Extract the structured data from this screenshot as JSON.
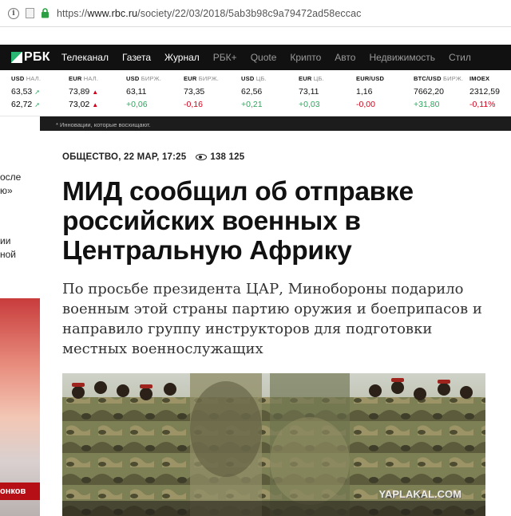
{
  "browser": {
    "url_scheme": "https://",
    "url_host": "www.rbc.ru",
    "url_path": "/society/22/03/2018/5ab3b98c9a79472ad58eccac"
  },
  "nav": {
    "logo": "РБК",
    "items": [
      {
        "label": "Телеканал",
        "dim": false
      },
      {
        "label": "Газета",
        "dim": false
      },
      {
        "label": "Журнал",
        "dim": false
      },
      {
        "label": "РБК+",
        "dim": true
      },
      {
        "label": "Quote",
        "dim": true
      },
      {
        "label": "Крипто",
        "dim": true
      },
      {
        "label": "Авто",
        "dim": true
      },
      {
        "label": "Недвижимость",
        "dim": true
      },
      {
        "label": "Стил",
        "dim": true
      }
    ]
  },
  "tickers": [
    {
      "label": "USD",
      "sub": "НАЛ.",
      "v1": "63,53",
      "d1": "up",
      "v2": "62,72",
      "d2": "up",
      "change": ""
    },
    {
      "label": "EUR",
      "sub": "НАЛ.",
      "v1": "73,89",
      "d1": "down",
      "v2": "73,02",
      "d2": "down",
      "change": ""
    },
    {
      "label": "USD",
      "sub": "БИРЖ.",
      "v1": "63,11",
      "d1": "",
      "v2": "+0,06",
      "d2": "upcolor",
      "change": ""
    },
    {
      "label": "EUR",
      "sub": "БИРЖ.",
      "v1": "73,35",
      "d1": "",
      "v2": "-0,16",
      "d2": "downcolor",
      "change": ""
    },
    {
      "label": "USD",
      "sub": "ЦБ.",
      "v1": "62,56",
      "d1": "",
      "v2": "+0,21",
      "d2": "upcolor",
      "change": ""
    },
    {
      "label": "EUR",
      "sub": "ЦБ.",
      "v1": "73,11",
      "d1": "",
      "v2": "+0,03",
      "d2": "upcolor",
      "change": ""
    },
    {
      "label": "EUR/USD",
      "sub": "",
      "v1": "1,16",
      "d1": "",
      "v2": "-0,00",
      "d2": "downcolor",
      "change": ""
    },
    {
      "label": "BTC/USD",
      "sub": "БИРЖ.",
      "v1": "7662,20",
      "d1": "",
      "v2": "+31,80",
      "d2": "upcolor",
      "change": ""
    },
    {
      "label": "IMOEX",
      "sub": "",
      "v1": "2312,59",
      "d1": "",
      "v2": "-0,11%",
      "d2": "downcolor",
      "change": ""
    }
  ],
  "left": {
    "text1a": "осле",
    "text1b": "ю»",
    "text2a": "ии",
    "text2b": "ной",
    "promo": "онков"
  },
  "banner": "* Инновации, которые восхищают.",
  "article": {
    "category_date": "ОБЩЕСТВО, 22 МАР, 17:25",
    "views": "138 125",
    "headline": "МИД сообщил об отправке российских военных в Центральную Африку",
    "lead": "По просьбе президента ЦАР, Минобороны подарило военным этой страны партию оружия и боеприпасов и направило группу инструкторов для подготовки местных военнослужащих"
  },
  "watermark": "YAPLAKAL.COM",
  "colors": {
    "up": "#2aa75b",
    "down": "#d0021b",
    "nav_bg": "#111111",
    "brand": "#2bb673"
  }
}
